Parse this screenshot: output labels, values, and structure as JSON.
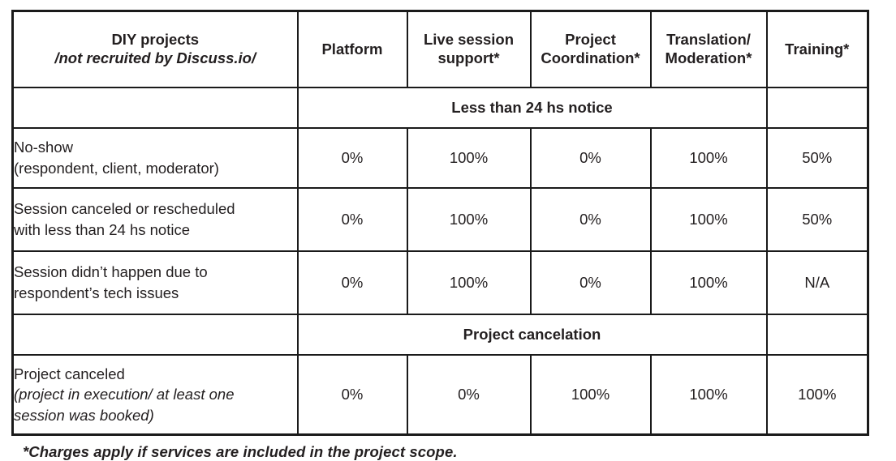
{
  "table": {
    "headers": {
      "label_line1": "DIY projects",
      "label_line2": "/not recruited by Discuss.io/",
      "platform": "Platform",
      "live_session_support_line1": "Live session",
      "live_session_support_line2": "support*",
      "project_coordination_line1": "Project",
      "project_coordination_line2": "Coordination*",
      "translation_moderation_line1": "Translation/",
      "translation_moderation_line2": "Moderation*",
      "training": "Training*"
    },
    "sections": [
      {
        "title": "Less than 24 hs notice",
        "rows": [
          {
            "label_line1": "No-show",
            "label_line2": "(respondent, client, moderator)",
            "label_line3": "",
            "platform": "0%",
            "live_session_support": "100%",
            "project_coordination": "0%",
            "translation_moderation": "100%",
            "training": "50%"
          },
          {
            "label_line1": "Session canceled or rescheduled",
            "label_line2": "with less than 24 hs notice",
            "label_line3": "",
            "platform": "0%",
            "live_session_support": "100%",
            "project_coordination": "0%",
            "translation_moderation": "100%",
            "training": "50%"
          },
          {
            "label_line1": "Session didn’t happen due to",
            "label_line2": "respondent’s tech issues",
            "label_line3": "",
            "platform": "0%",
            "live_session_support": "100%",
            "project_coordination": "0%",
            "translation_moderation": "100%",
            "training": "N/A"
          }
        ]
      },
      {
        "title": "Project cancelation",
        "rows": [
          {
            "label_line1": "Project canceled",
            "label_line2": "(project in execution/ at least one",
            "label_line3": "session was booked)",
            "platform": "0%",
            "live_session_support": "0%",
            "project_coordination": "100%",
            "translation_moderation": "100%",
            "training": "100%"
          }
        ]
      }
    ]
  },
  "footnote": "*Charges apply if services are included in the project scope.",
  "colors": {
    "section_band": "#D9D9D9",
    "border": "#1A1A1A",
    "text": "#231F20",
    "background": "#FFFFFF"
  }
}
